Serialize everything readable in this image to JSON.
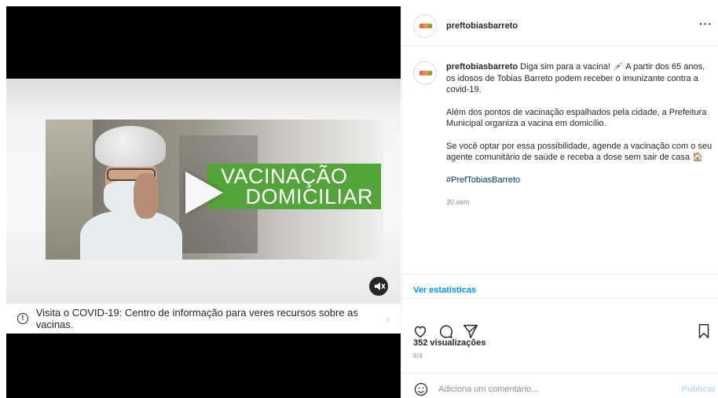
{
  "media": {
    "banner_line1": "VACINAÇÃO",
    "banner_line2": "DOMICILIAR",
    "banner_color": "#55a33b",
    "play_icon": "play-icon",
    "mute_icon": "speaker-muted-icon",
    "info_text": "Visita o COVID-19: Centro de informação para veres recursos sobre as vacinas.",
    "info_icon": "info-icon",
    "chevron": "›"
  },
  "post": {
    "username": "preftobiasbarreto",
    "more_label": "···",
    "caption_paragraphs": [
      "Diga sim para a vacina! 💉 A partir dos 65 anos, os idosos de Tobias Barreto podem receber o imunizante contra a covid-19.",
      "Além dos pontos de vacinação espalhados pela cidade, a Prefeitura Municipal organiza a vacina em domicílio.",
      "Se você optar por essa possibilidade, agende a vacinação com o seu agente comunitário de saúde e receba a dose sem sair de casa 🏠"
    ],
    "hashtag": "#PrefTobiasBarreto",
    "time_ago": "30 sem",
    "stats_link": "Ver estatísticas",
    "views": "352 visualizações",
    "date": "6/4",
    "comment_placeholder": "Adiciona um comentário...",
    "publish_label": "Publicar",
    "link_color": "#0095f6"
  }
}
